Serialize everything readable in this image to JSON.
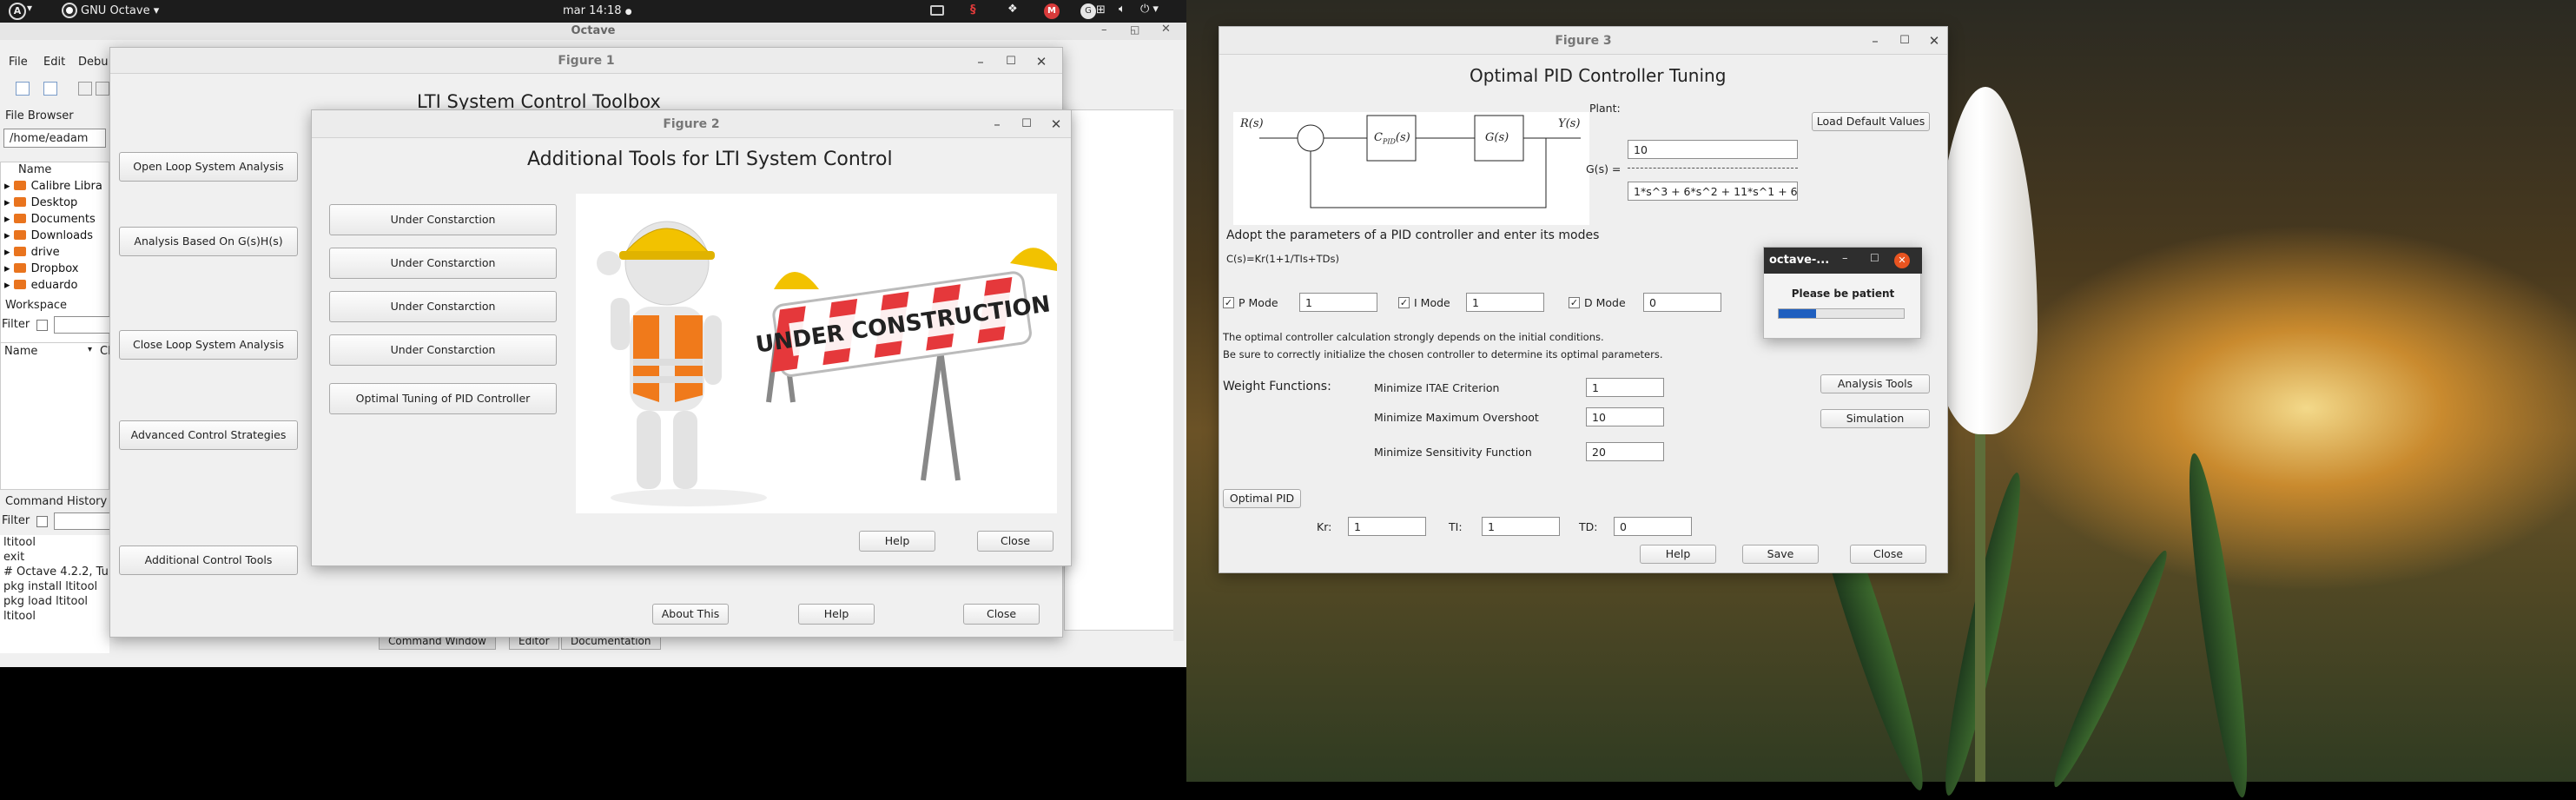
{
  "topbar": {
    "app_label": "GNU Octave",
    "clock": "mar 14:18"
  },
  "octave": {
    "title": "Octave",
    "menu": [
      "File",
      "Edit",
      "Debu"
    ],
    "file_browser": {
      "title": "File Browser",
      "path": "/home/eadam",
      "column": "Name",
      "items": [
        "Calibre Libra",
        "Desktop",
        "Documents",
        "Downloads",
        "drive",
        "Dropbox",
        "eduardo"
      ]
    },
    "workspace": {
      "title": "Workspace",
      "filter_label": "Filter",
      "col_name": "Name",
      "col_class": "Cl"
    },
    "history": {
      "title": "Command History",
      "filter_label": "Filter",
      "entries": [
        "ltitool",
        "exit",
        "# Octave 4.2.2, Tu",
        "pkg install ltitool",
        "pkg load ltitool",
        "ltitool"
      ]
    },
    "bottom_tabs": [
      "Command Window",
      "Editor",
      "Documentation"
    ]
  },
  "fig1": {
    "title": "Figure 1",
    "heading": "LTI System Control Toolbox",
    "buttons": [
      "Open Loop System Analysis",
      "Analysis Based On G(s)H(s)",
      "Close Loop System Analysis",
      "Advanced Control Strategies",
      "Additional Control Tools"
    ],
    "footer": [
      "About This",
      "Help",
      "Close"
    ]
  },
  "fig2": {
    "title": "Figure 2",
    "heading": "Additional Tools for LTI System Control",
    "buttons": [
      "Under Constarction",
      "Under Constarction",
      "Under Constarction",
      "Under Constarction",
      "Optimal Tuning of  PID Controller"
    ],
    "sign_text": "UNDER CONSTRUCTION",
    "footer": [
      "Help",
      "Close"
    ]
  },
  "fig3": {
    "title": "Figure 3",
    "heading": "Optimal PID Controller Tuning",
    "diagram": {
      "r": "R(s)",
      "c": "C",
      "c_sub": "PID",
      "c_arg": "(s)",
      "g": "G(s)",
      "y": "Y(s)"
    },
    "plant_label": "Plant:",
    "load_defaults": "Load Default Values",
    "g_label": "G(s) =",
    "numerator": "10",
    "denominator": "1*s^3 + 6*s^2 + 11*s^1 + 6",
    "adopt_text": "Adopt the parameters of a PID controller and enter its modes",
    "formula": "C(s)=Kr(1+1/TIs+TDs)",
    "modes": [
      {
        "label": "P Mode",
        "value": "1"
      },
      {
        "label": "I Mode",
        "value": "1"
      },
      {
        "label": "D Mode",
        "value": "0"
      }
    ],
    "note1": "The optimal controller calculation strongly depends on the initial conditions.",
    "note2": "Be sure to correctly initialize the chosen controller to determine its optimal parameters.",
    "weight_title": "Weight Functions:",
    "weights": [
      {
        "label": "Minimize ITAE Criterion",
        "value": "1"
      },
      {
        "label": "Minimize Maximum Overshoot",
        "value": "10"
      },
      {
        "label": "Minimize Sensitivity Function",
        "value": "20"
      }
    ],
    "analysis_tools": "Analysis Tools",
    "simulation": "Simulation",
    "optimal_pid": "Optimal PID",
    "results": [
      {
        "label": "Kr:",
        "value": "1"
      },
      {
        "label": "TI:",
        "value": "1"
      },
      {
        "label": "TD:",
        "value": "0"
      }
    ],
    "footer": [
      "Help",
      "Save",
      "Close"
    ]
  },
  "popup": {
    "title": "octave-...",
    "message": "Please be patient",
    "progress": 0.3
  }
}
